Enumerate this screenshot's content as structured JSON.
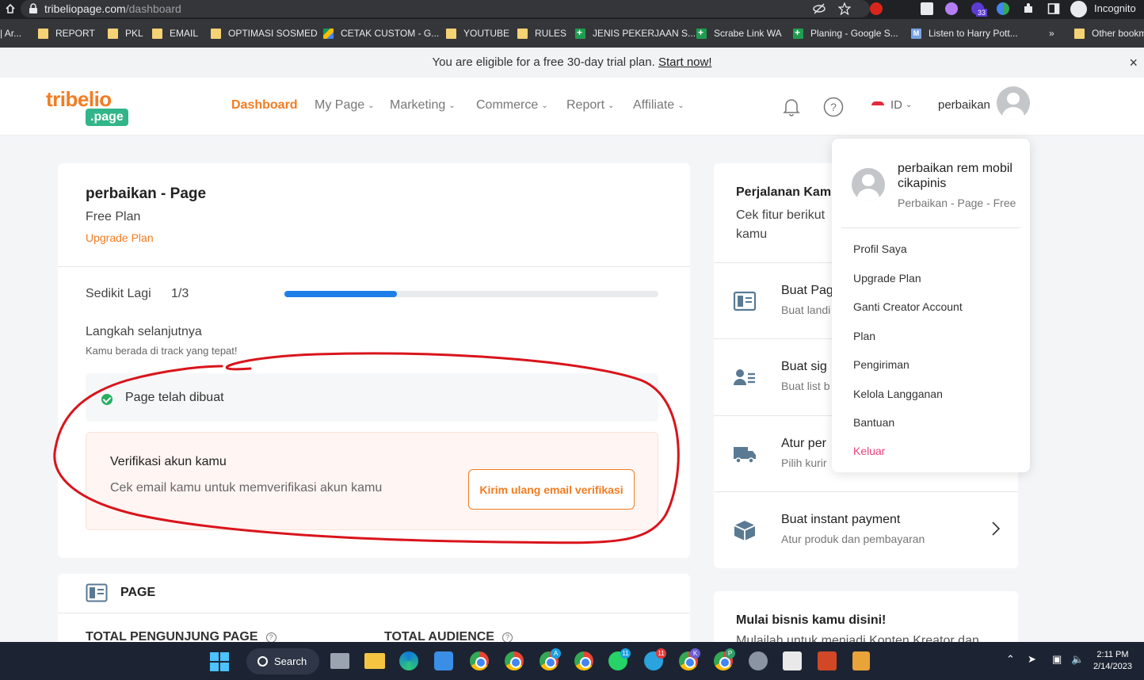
{
  "browser": {
    "url_host": "tribeliopage.com",
    "url_path": "/dashboard",
    "incognito_label": "Incognito",
    "extension_badge": "33",
    "bookmarks": [
      {
        "label": "| Ar...",
        "icon": "none"
      },
      {
        "label": "REPORT",
        "icon": "folder"
      },
      {
        "label": "PKL",
        "icon": "folder"
      },
      {
        "label": "EMAIL",
        "icon": "folder"
      },
      {
        "label": "OPTIMASI SOSMED",
        "icon": "folder"
      },
      {
        "label": "CETAK CUSTOM - G...",
        "icon": "drive"
      },
      {
        "label": "YOUTUBE",
        "icon": "folder"
      },
      {
        "label": "RULES",
        "icon": "folder"
      },
      {
        "label": "JENIS PEKERJAAN S...",
        "icon": "sheet"
      },
      {
        "label": "Scrabe Link WA",
        "icon": "sheet"
      },
      {
        "label": "Planing - Google S...",
        "icon": "sheet"
      },
      {
        "label": "Listen to Harry Pott...",
        "icon": "m"
      },
      {
        "label": "»",
        "icon": "none"
      },
      {
        "label": "Other bookm",
        "icon": "folder"
      }
    ]
  },
  "trial_banner": {
    "text": "You are eligible for a free 30-day trial plan.",
    "link": "Start now!",
    "close": "×"
  },
  "header": {
    "logo_main": "tribelio",
    "logo_sub": ".page",
    "nav": [
      {
        "label": "Dashboard",
        "active": true,
        "dropdown": false
      },
      {
        "label": "My Page",
        "active": false,
        "dropdown": true
      },
      {
        "label": "Marketing",
        "active": false,
        "dropdown": true
      },
      {
        "label": "Commerce",
        "active": false,
        "dropdown": true
      },
      {
        "label": "Report",
        "active": false,
        "dropdown": true
      },
      {
        "label": "Affiliate",
        "active": false,
        "dropdown": true
      }
    ],
    "lang": "ID",
    "username": "perbaikan"
  },
  "main_card": {
    "title": "perbaikan - Page",
    "plan": "Free Plan",
    "upgrade": "Upgrade Plan",
    "progress_label": "Sedikit Lagi",
    "progress_count": "1/3",
    "progress_fraction": 0.3,
    "next_step": "Langkah selanjutnya",
    "next_sub": "Kamu berada di track yang tepat!",
    "step_done": "Page telah dibuat",
    "verify_title": "Verifikasi akun kamu",
    "verify_sub": "Cek email kamu untuk memverifikasi akun kamu",
    "verify_button": "Kirim ulang email verifikasi"
  },
  "page_card": {
    "title": "PAGE",
    "stat1": "TOTAL PENGUNJUNG PAGE",
    "stat2": "TOTAL AUDIENCE"
  },
  "journey_card": {
    "title": "Perjalanan Kam",
    "subtitle": "Cek fitur berikut kamu",
    "rows": [
      {
        "title": "Buat Pag",
        "sub": "Buat landi",
        "icon": "page-layout-icon"
      },
      {
        "title": "Buat sig",
        "sub": "Buat list b",
        "icon": "contacts-icon"
      },
      {
        "title": "Atur per",
        "sub": "Pilih kurir",
        "icon": "truck-icon"
      },
      {
        "title": "Buat instant payment",
        "sub": "Atur produk dan pembayaran",
        "icon": "package-icon"
      }
    ]
  },
  "biz_card": {
    "title": "Mulai bisnis kamu disini!",
    "sub": "Mulailah untuk menjadi Konten Kreator dan"
  },
  "dropdown": {
    "name": "perbaikan rem mobil cikapinis",
    "sub": "Perbaikan - Page - Free",
    "items": [
      "Profil Saya",
      "Upgrade Plan",
      "Ganti Creator Account",
      "Plan",
      "Pengiriman",
      "Kelola Langganan",
      "Bantuan"
    ],
    "logout": "Keluar"
  },
  "taskbar": {
    "search_label": "Search",
    "badges": [
      "A",
      "11",
      "11",
      "K",
      "P"
    ],
    "time": "2:11 PM",
    "date": "2/14/2023"
  },
  "colors": {
    "accent": "#f37c22",
    "brand_green": "#33b58a",
    "progress": "#1e7fe8",
    "logout": "#e8457a",
    "annotation": "#d9141b"
  }
}
